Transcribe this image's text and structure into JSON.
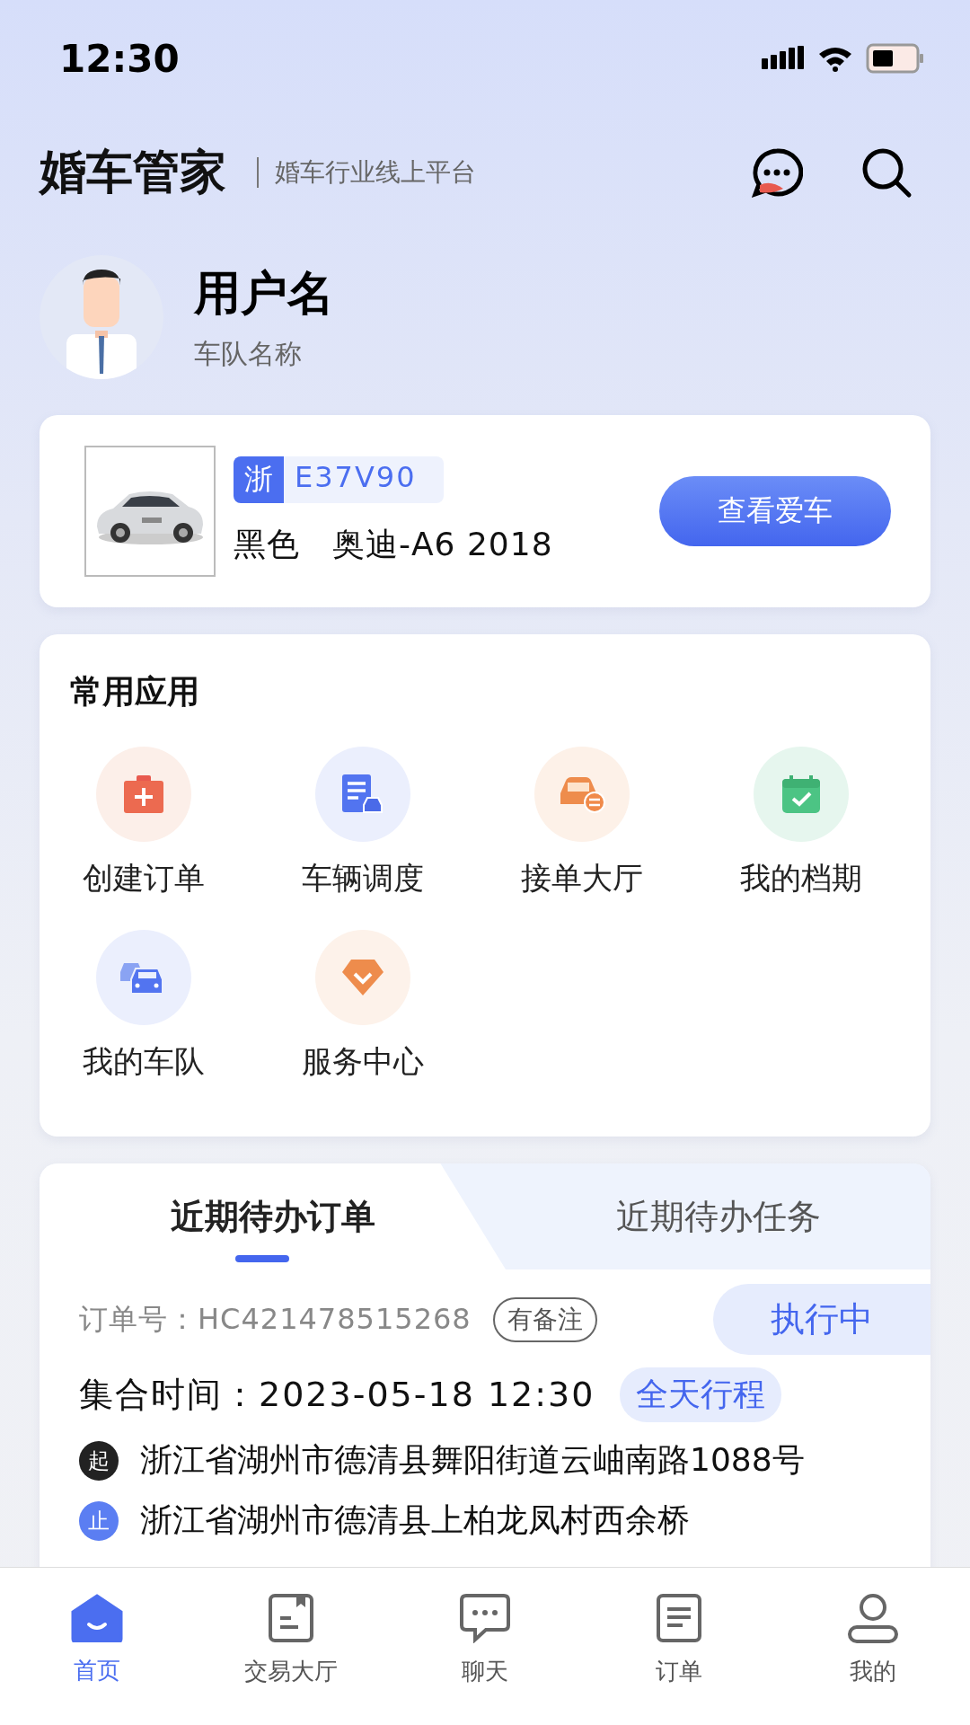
{
  "status_bar": {
    "time": "12:30"
  },
  "header": {
    "title": "婚车管家",
    "subtitle": "婚车行业线上平台"
  },
  "profile": {
    "name": "用户名",
    "team": "车队名称"
  },
  "car": {
    "plate_province": "浙",
    "plate_number": "E37V90",
    "paint": "黑色",
    "model": "奥迪-A6 2018",
    "button": "查看爱车"
  },
  "apps": {
    "title": "常用应用",
    "items": [
      {
        "kind": "kit",
        "label": "创建订单"
      },
      {
        "kind": "doc",
        "label": "车辆调度"
      },
      {
        "kind": "exchange",
        "label": "接单大厅"
      },
      {
        "kind": "calendar",
        "label": "我的档期"
      },
      {
        "kind": "fleet",
        "label": "我的车队"
      },
      {
        "kind": "diamond",
        "label": "服务中心"
      }
    ]
  },
  "tabs": [
    {
      "label": "近期待办订单",
      "selected": true
    },
    {
      "label": "近期待办任务",
      "selected": false
    }
  ],
  "order": {
    "number_label": "订单号：",
    "number": "HC421478515268",
    "note_tag": "有备注",
    "status": "执行中",
    "time_label": "集合时间：",
    "time": "2023-05-18 12:30",
    "trip_tag": "全天行程",
    "stops": [
      {
        "kind": "start",
        "marker": "起",
        "address": "浙江省湖州市德清县舞阳街道云岫南路1088号"
      },
      {
        "kind": "stop",
        "marker": "止",
        "address": "浙江省湖州市德清县上柏龙凤村西余桥"
      }
    ]
  },
  "nav": [
    {
      "kind": "home",
      "label": "首页",
      "selected": true
    },
    {
      "kind": "hall",
      "label": "交易大厅",
      "selected": false
    },
    {
      "kind": "chat",
      "label": "聊天",
      "selected": false
    },
    {
      "kind": "order",
      "label": "订单",
      "selected": false
    },
    {
      "kind": "me",
      "label": "我的",
      "selected": false
    }
  ]
}
